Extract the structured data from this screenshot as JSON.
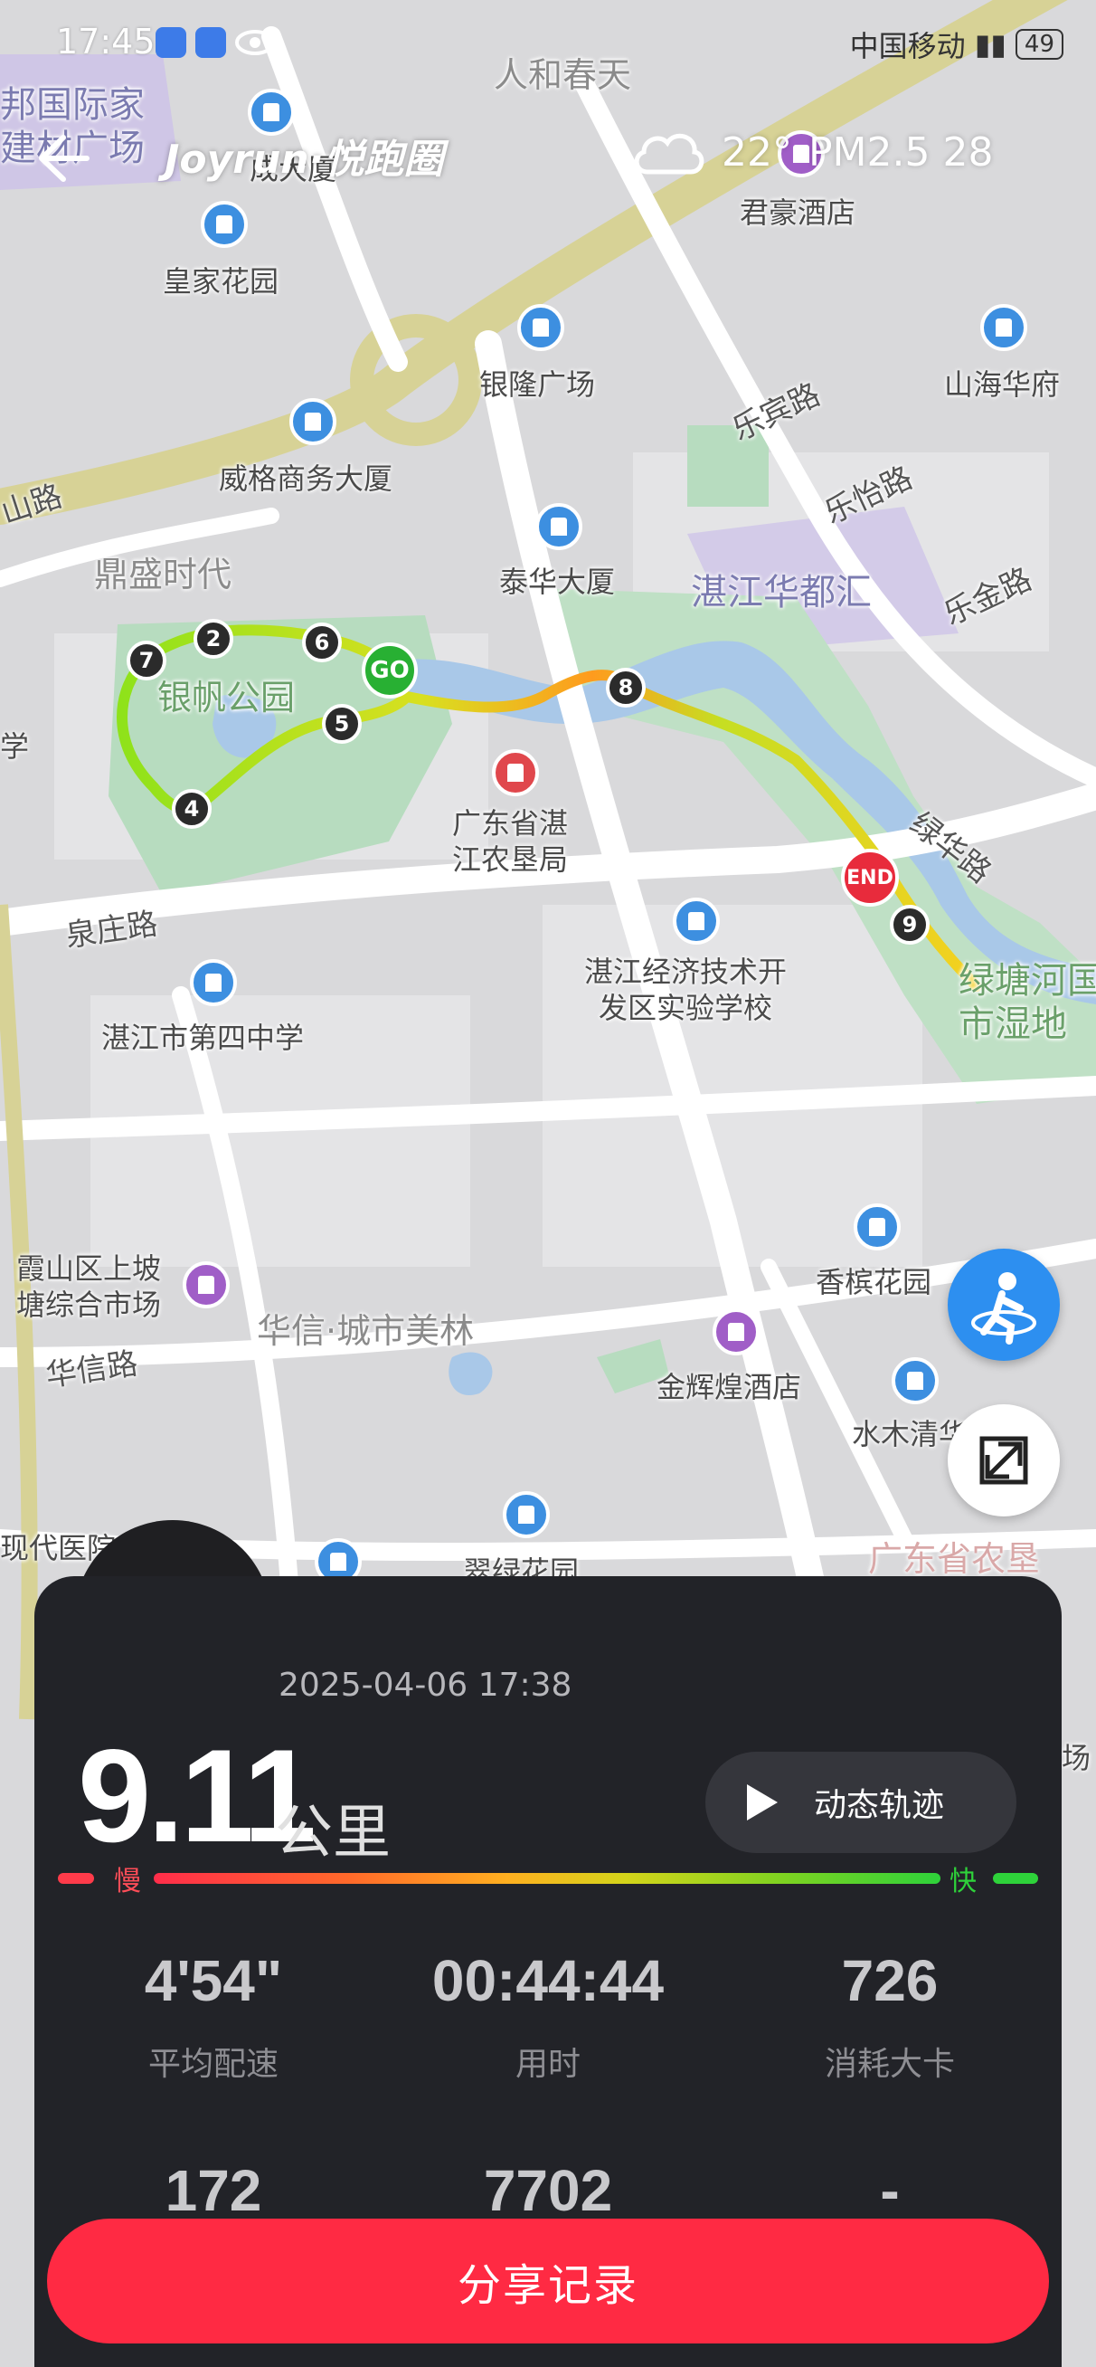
{
  "status_bar": {
    "time": "17:45",
    "carrier": "中国移动",
    "battery": "49"
  },
  "header": {
    "brand": "Joyrun·悦跑圈",
    "temperature": "22°",
    "air_quality": "PM2.5 28"
  },
  "map": {
    "labels": {
      "renhe": "人和春天",
      "bangguo": "邦国际家\n建材广场",
      "junhao": "君豪酒店",
      "huangjia": "皇家花园",
      "cheng": "成大厦",
      "yinlong": "银隆广场",
      "lebin": "乐宾路",
      "shanhai": "山海华府",
      "weige": "威格商务大厦",
      "leyi": "乐怡路",
      "shanlu": "山路",
      "dingsheng": "鼎盛时代",
      "taihua": "泰华大厦",
      "huadu": "湛江华都汇",
      "lejin": "乐金路",
      "yinfan": "银帆公园",
      "xue": "学",
      "nongken": "广东省湛\n江农垦局",
      "lvhua": "绿华路",
      "quanzhuang": "泉庄路",
      "lutang": "绿塘河国\n市湿地",
      "shiyan": "湛江经济技术开\n发区实验学校",
      "sizhong": "湛江市第四中学",
      "xiangbin": "香槟花园",
      "xiashan": "霞山区上坡\n塘综合市场",
      "huaxin_city": "华信·城市美林",
      "huaxin_road": "华信路",
      "jinhui": "金辉煌酒店",
      "shuimu": "水木清华",
      "xiandai": "现代医院",
      "cuilv": "翠绿花园",
      "guangdong_nk": "广东省农垦",
      "chang": "场"
    },
    "km_markers": [
      "2",
      "6",
      "7",
      "5",
      "4",
      "8",
      "9"
    ],
    "start_label": "GO",
    "end_label": "END"
  },
  "run": {
    "date": "2025-04-06 17:38",
    "distance": "9.11",
    "distance_unit": "公里",
    "replay_label": "动态轨迹",
    "slow_label": "慢",
    "fast_label": "快",
    "stats": [
      {
        "value": "4'54\"",
        "label": "平均配速"
      },
      {
        "value": "00:44:44",
        "label": "用时"
      },
      {
        "value": "726",
        "label": "消耗大卡"
      },
      {
        "value": "172",
        "label": ""
      },
      {
        "value": "7702",
        "label": ""
      },
      {
        "value": "-",
        "label": ""
      }
    ]
  },
  "share_label": "分享记录",
  "colors": {
    "accent": "#ff2a43",
    "panel": "#222328",
    "route_fast": "#2ed23a",
    "route_slow": "#ff7a1a"
  }
}
